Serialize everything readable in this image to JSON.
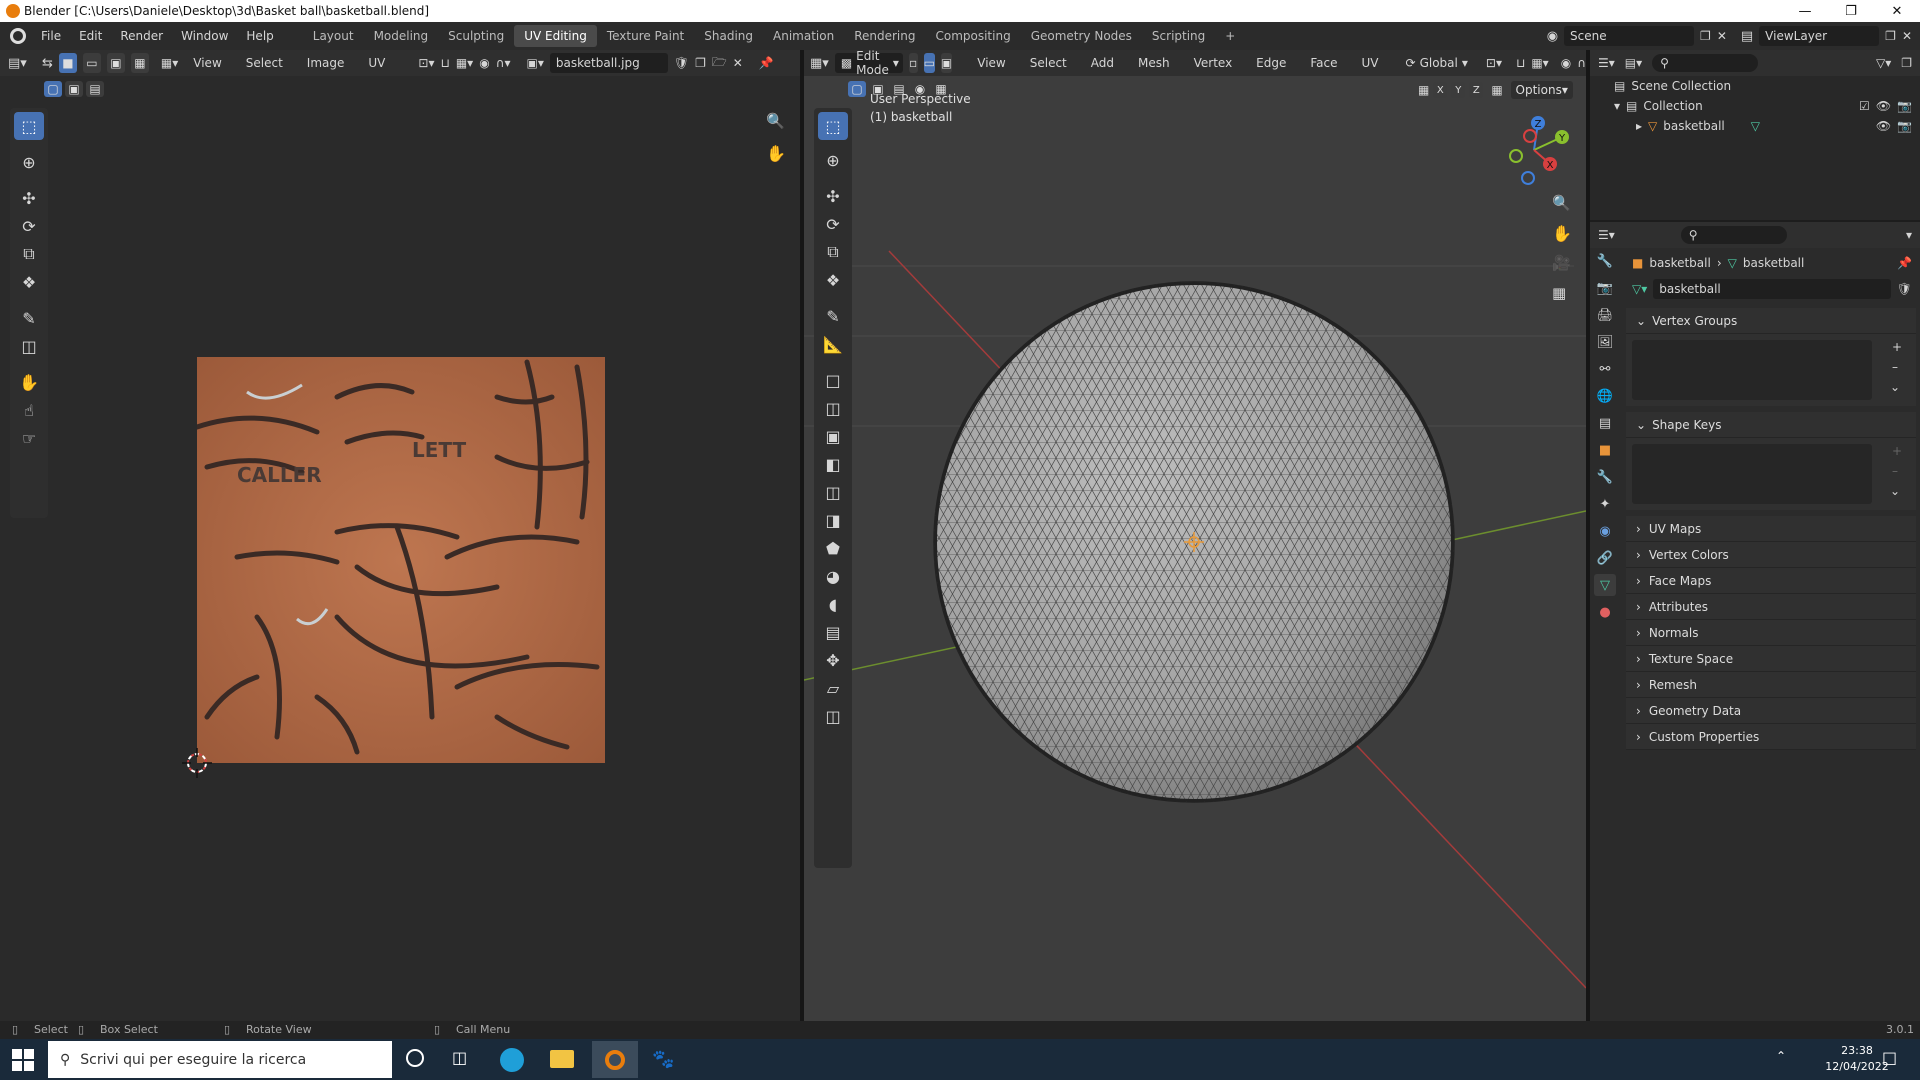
{
  "window": {
    "title": "Blender [C:\\Users\\Daniele\\Desktop\\3d\\Basket ball\\basketball.blend]"
  },
  "menu": [
    "File",
    "Edit",
    "Render",
    "Window",
    "Help"
  ],
  "workspaces": [
    "Layout",
    "Modeling",
    "Sculpting",
    "UV Editing",
    "Texture Paint",
    "Shading",
    "Animation",
    "Rendering",
    "Compositing",
    "Geometry Nodes",
    "Scripting"
  ],
  "active_workspace": "UV Editing",
  "scene": {
    "name": "Scene",
    "view_layer": "ViewLayer"
  },
  "uv_editor": {
    "menus": [
      "View",
      "Select",
      "Image",
      "UV"
    ],
    "image_name": "basketball.jpg",
    "texture_labels": [
      "CALLER",
      "LETT"
    ]
  },
  "viewport": {
    "mode": "Edit Mode",
    "menus": [
      "View",
      "Select",
      "Add",
      "Mesh",
      "Vertex",
      "Edge",
      "Face",
      "UV"
    ],
    "orientation": "Global",
    "axes_lock": [
      "X",
      "Y",
      "Z"
    ],
    "options": "Options",
    "overlay_line1": "User Perspective",
    "overlay_line2": "(1) basketball",
    "gizmo_axes": [
      "Z",
      "Y",
      "X"
    ]
  },
  "outliner": {
    "scene_collection": "Scene Collection",
    "collection": "Collection",
    "object": "basketball"
  },
  "properties": {
    "breadcrumb_object": "basketball",
    "breadcrumb_mesh": "basketball",
    "mesh_name": "basketball",
    "panels": [
      "Vertex Groups",
      "Shape Keys",
      "UV Maps",
      "Vertex Colors",
      "Face Maps",
      "Attributes",
      "Normals",
      "Texture Space",
      "Remesh",
      "Geometry Data",
      "Custom Properties"
    ]
  },
  "status": {
    "select": "Select",
    "box_select": "Box Select",
    "rotate": "Rotate View",
    "call_menu": "Call Menu",
    "version": "3.0.1"
  },
  "taskbar": {
    "search_placeholder": "Scrivi qui per eseguire la ricerca",
    "time": "23:38",
    "date": "12/04/2022"
  },
  "colors": {
    "accent": "#4772b3",
    "texture": "#b46a44",
    "x_axis": "#d84040",
    "y_axis": "#8ac02e",
    "z_axis": "#3f7fdb"
  }
}
